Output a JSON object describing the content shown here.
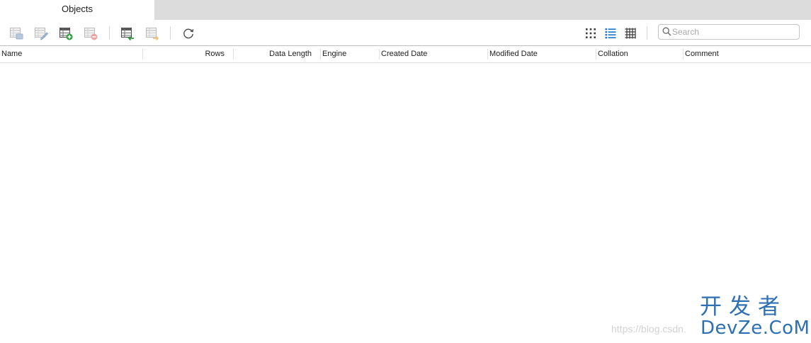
{
  "tabs": [
    {
      "label": "Objects"
    }
  ],
  "toolbar": {
    "buttons": [
      {
        "icon": "open-table-icon",
        "enabled": false
      },
      {
        "icon": "design-table-icon",
        "enabled": false
      },
      {
        "icon": "new-table-icon",
        "enabled": true
      },
      {
        "icon": "delete-table-icon",
        "enabled": false
      },
      {
        "icon": "import-wizard-icon",
        "enabled": true
      },
      {
        "icon": "export-wizard-icon",
        "enabled": false
      },
      {
        "icon": "refresh-icon",
        "enabled": true
      }
    ],
    "view_modes": [
      "grid-view-icon",
      "list-view-icon",
      "detail-view-icon"
    ],
    "active_view": "list-view-icon",
    "search": {
      "placeholder": "Search",
      "value": ""
    }
  },
  "table": {
    "columns": [
      {
        "label": "Name"
      },
      {
        "label": "Rows"
      },
      {
        "label": "Data Length"
      },
      {
        "label": "Engine"
      },
      {
        "label": "Created Date"
      },
      {
        "label": "Modified Date"
      },
      {
        "label": "Collation"
      },
      {
        "label": "Comment"
      }
    ],
    "rows": []
  },
  "watermark": {
    "url": "https://blog.csdn.",
    "brand_cn": "开发者",
    "brand_en": "DevZe.CoM"
  },
  "colors": {
    "accent": "#1a73c9",
    "green": "#2e9e3a",
    "red": "#d9534f",
    "watermark_blue": "#2f6fb4"
  }
}
